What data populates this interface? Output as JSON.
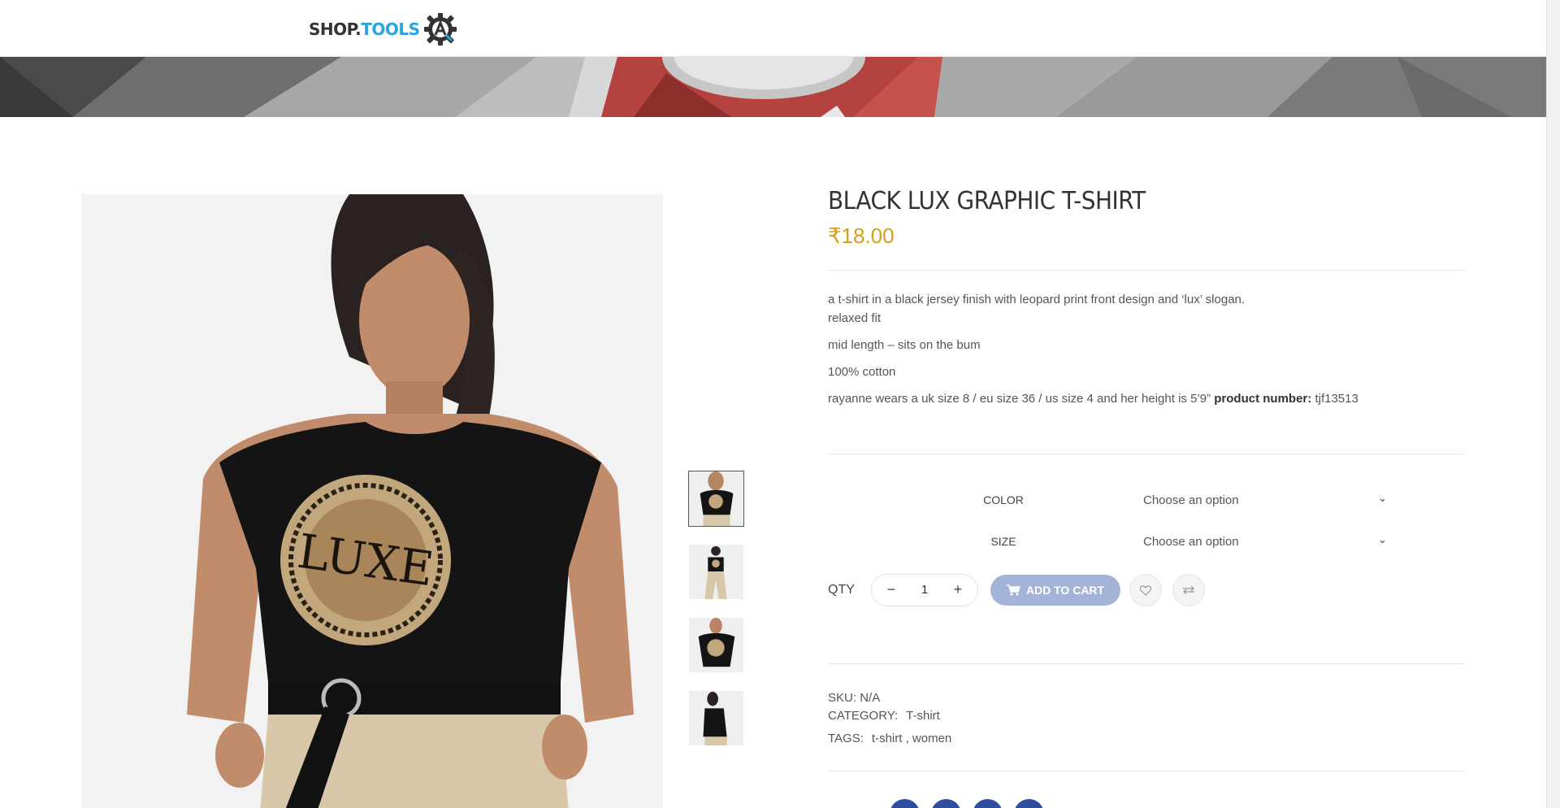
{
  "header": {
    "logo_shop": "SHOP.",
    "logo_tools": "TOOLS",
    "logo_icon": "gear-logo-icon"
  },
  "product": {
    "title": "BLACK LUX GRAPHIC T-SHIRT",
    "price": "₹18.00",
    "description_first": "a t-shirt in a black jersey finish with leopard print front design and ‘lux’ slogan.",
    "description_fit": "relaxed fit",
    "description_length": "mid length – sits on the bum",
    "description_material": "100% cotton",
    "description_model": "rayanne wears a uk size 8 / eu size 36 / us size 4 and her height is 5’9”",
    "product_number_label": "product number:",
    "product_number_value": "tjf13513"
  },
  "variations": {
    "color_label": "COLOR",
    "color_placeholder": "Choose an option",
    "size_label": "SIZE",
    "size_placeholder": "Choose an option"
  },
  "cart": {
    "qty_label": "QTY",
    "qty_value": "1",
    "minus_symbol": "−",
    "plus_symbol": "+",
    "add_to_cart_label": "ADD TO CART",
    "wishlist_icon": "heart-icon",
    "compare_icon": "compare-arrows-icon",
    "button_color": "#a4b4d8"
  },
  "meta": {
    "sku_label": "SKU:",
    "sku_value": "N/A",
    "category_label": "CATEGORY:",
    "category_value": "T-shirt",
    "tags_label": "TAGS:",
    "tags_value": "t-shirt , women"
  },
  "colors": {
    "price": "#d69e1b",
    "logo_accent": "#2aa5dc",
    "share": "#2f4ea0"
  },
  "thumbnails": [
    {
      "name": "thumbnail-front-closeup",
      "active": true
    },
    {
      "name": "thumbnail-full-body",
      "active": false
    },
    {
      "name": "thumbnail-front-detail",
      "active": false
    },
    {
      "name": "thumbnail-side-view",
      "active": false
    }
  ]
}
